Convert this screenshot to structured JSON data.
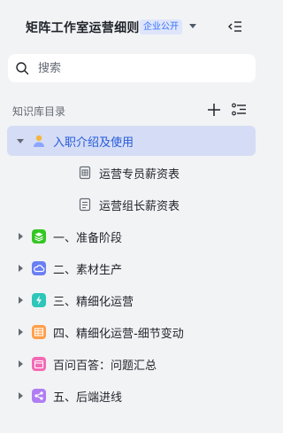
{
  "header": {
    "title": "矩阵工作室运营细则",
    "badge": "企业公开",
    "dropdown_icon": "chevron-down-icon",
    "collapse_icon": "collapse-sidebar-icon"
  },
  "search": {
    "placeholder": "搜索",
    "value": ""
  },
  "directory": {
    "label": "知识库目录",
    "add_icon": "plus-icon",
    "list_icon": "list-options-icon"
  },
  "tree": [
    {
      "label": "入职介绍及使用",
      "icon": "person-avatar-icon",
      "color": "#f5b43d",
      "expanded": true,
      "selected": true,
      "level": 0
    },
    {
      "label": "运营专员薪资表",
      "icon": "table-doc-icon",
      "color": "#646a73",
      "level": 1
    },
    {
      "label": "运营组长薪资表",
      "icon": "doc-icon",
      "color": "#646a73",
      "level": 1
    },
    {
      "label": "一、准备阶段",
      "icon": "layers-icon",
      "color": "#34c724",
      "level": 0
    },
    {
      "label": "二、素材生产",
      "icon": "cloud-icon",
      "color": "#6a7ff2",
      "level": 0
    },
    {
      "label": "三、精细化运营",
      "icon": "lightning-icon",
      "color": "#2ec6b9",
      "level": 0
    },
    {
      "label": "四、精细化运营-细节变动",
      "icon": "table-icon",
      "color": "#ff9f4a",
      "level": 0
    },
    {
      "label": "百问百答：问题汇总",
      "icon": "calendar-icon",
      "color": "#f36ab5",
      "level": 0
    },
    {
      "label": "五、后端进线",
      "icon": "share-nodes-icon",
      "color": "#b07ef3",
      "level": 0
    }
  ]
}
